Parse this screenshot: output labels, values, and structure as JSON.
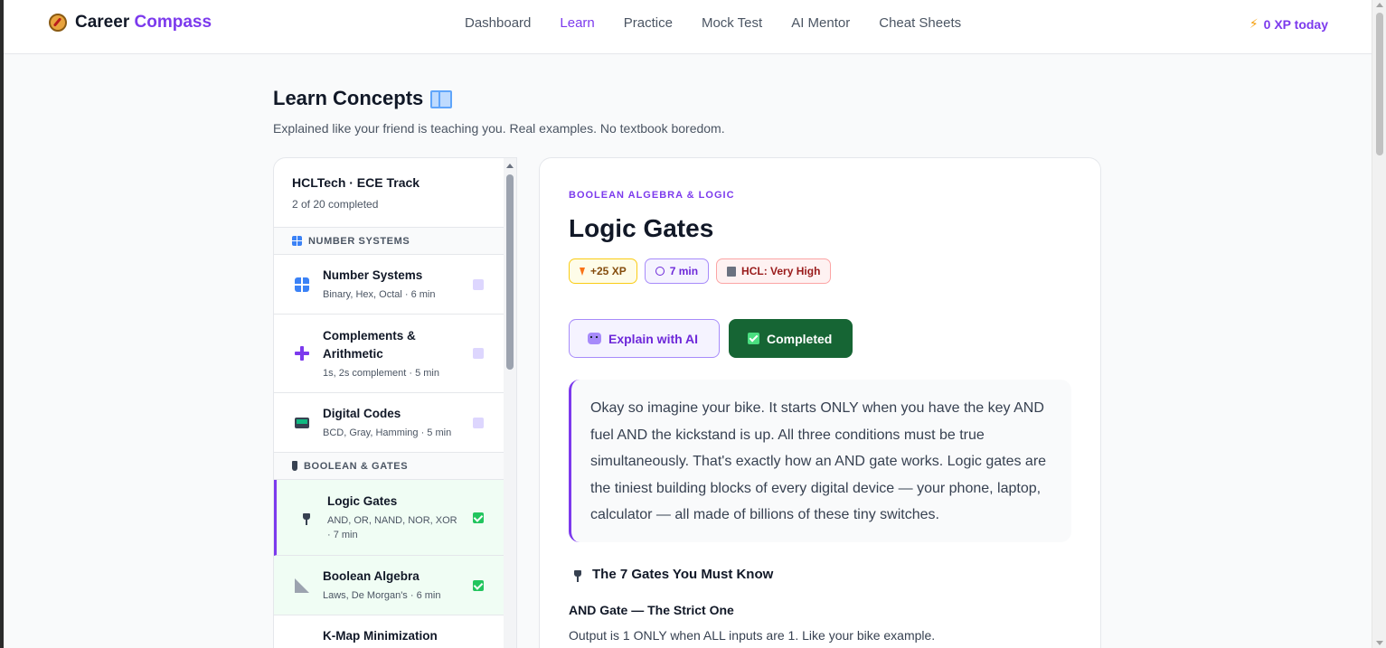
{
  "header": {
    "brand_first": "Career",
    "brand_second": "Compass",
    "nav": [
      "Dashboard",
      "Learn",
      "Practice",
      "Mock Test",
      "AI Mentor",
      "Cheat Sheets"
    ],
    "active_nav": "Learn",
    "xp_today": "0 XP today",
    "accent_color": "#7c3aed"
  },
  "page": {
    "title": "Learn Concepts",
    "subtitle": "Explained like your friend is teaching you. Real examples. No textbook boredom."
  },
  "sidebar": {
    "track_title": "HCLTech · ECE Track",
    "track_progress": "2 of 20 completed",
    "sections": [
      {
        "label": "NUMBER SYSTEMS",
        "lessons": [
          {
            "title": "Number Systems",
            "meta": "Binary, Hex, Octal · 6 min",
            "icon": "grid-icon",
            "status": "pending"
          },
          {
            "title": "Complements & Arithmetic",
            "meta": "1s, 2s complement · 5 min",
            "icon": "plus-icon",
            "status": "pending"
          },
          {
            "title": "Digital Codes",
            "meta": "BCD, Gray, Hamming · 5 min",
            "icon": "screen-icon",
            "status": "pending"
          }
        ]
      },
      {
        "label": "BOOLEAN & GATES",
        "lessons": [
          {
            "title": "Logic Gates",
            "meta": "AND, OR, NAND, NOR, XOR · 7 min",
            "icon": "plug-icon",
            "status": "completed",
            "active": true
          },
          {
            "title": "Boolean Algebra",
            "meta": "Laws, De Morgan's · 6 min",
            "icon": "ruler-icon",
            "status": "completed"
          },
          {
            "title": "K-Map Minimization",
            "meta": "",
            "icon": "kmap-icon",
            "status": "pending"
          }
        ]
      }
    ]
  },
  "lesson": {
    "category": "BOOLEAN ALGEBRA & LOGIC",
    "title": "Logic Gates",
    "chips": {
      "xp": "+25 XP",
      "time": "7 min",
      "company": "HCL: Very High"
    },
    "actions": {
      "explain": "Explain with AI",
      "completed": "Completed"
    },
    "intro": "Okay so imagine your bike. It starts ONLY when you have the key AND fuel AND the kickstand is up. All three conditions must be true simultaneously. That's exactly how an AND gate works. Logic gates are the tiniest building blocks of every digital device — your phone, laptop, calculator — all made of billions of these tiny switches.",
    "section_title": "The 7 Gates You Must Know",
    "gate_title": "AND Gate — The Strict One",
    "gate_desc": "Output is 1 ONLY when ALL inputs are 1. Like your bike example."
  }
}
